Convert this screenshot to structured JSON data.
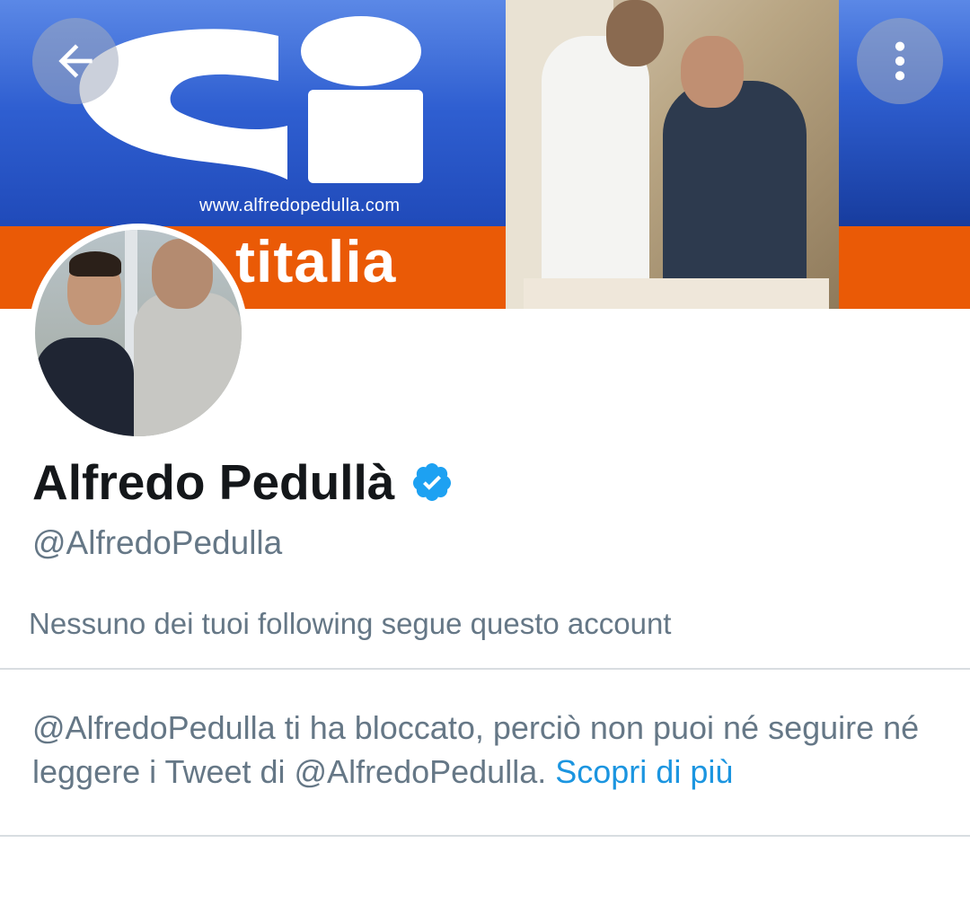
{
  "banner": {
    "url": "www.alfredopedulla.com",
    "word": "titalia"
  },
  "nav": {
    "back_icon": "arrow-left-icon",
    "more_icon": "more-vertical-icon"
  },
  "profile": {
    "name": "Alfredo Pedullà",
    "verified_icon": "verified-badge-icon",
    "handle": "@AlfredoPedulla",
    "followers_note": "Nessuno dei tuoi following segue questo account"
  },
  "blocked": {
    "message": "@AlfredoPedulla ti ha bloccato, perciò non puoi né seguire né leggere i Tweet di @AlfredoPedulla.",
    "learn_more": "Scopri di più"
  },
  "colors": {
    "link": "#1b95e0",
    "secondary_text": "#657786",
    "verified": "#1da1f2",
    "banner_orange": "#ea5a06",
    "banner_blue": "#2f5fd1"
  }
}
